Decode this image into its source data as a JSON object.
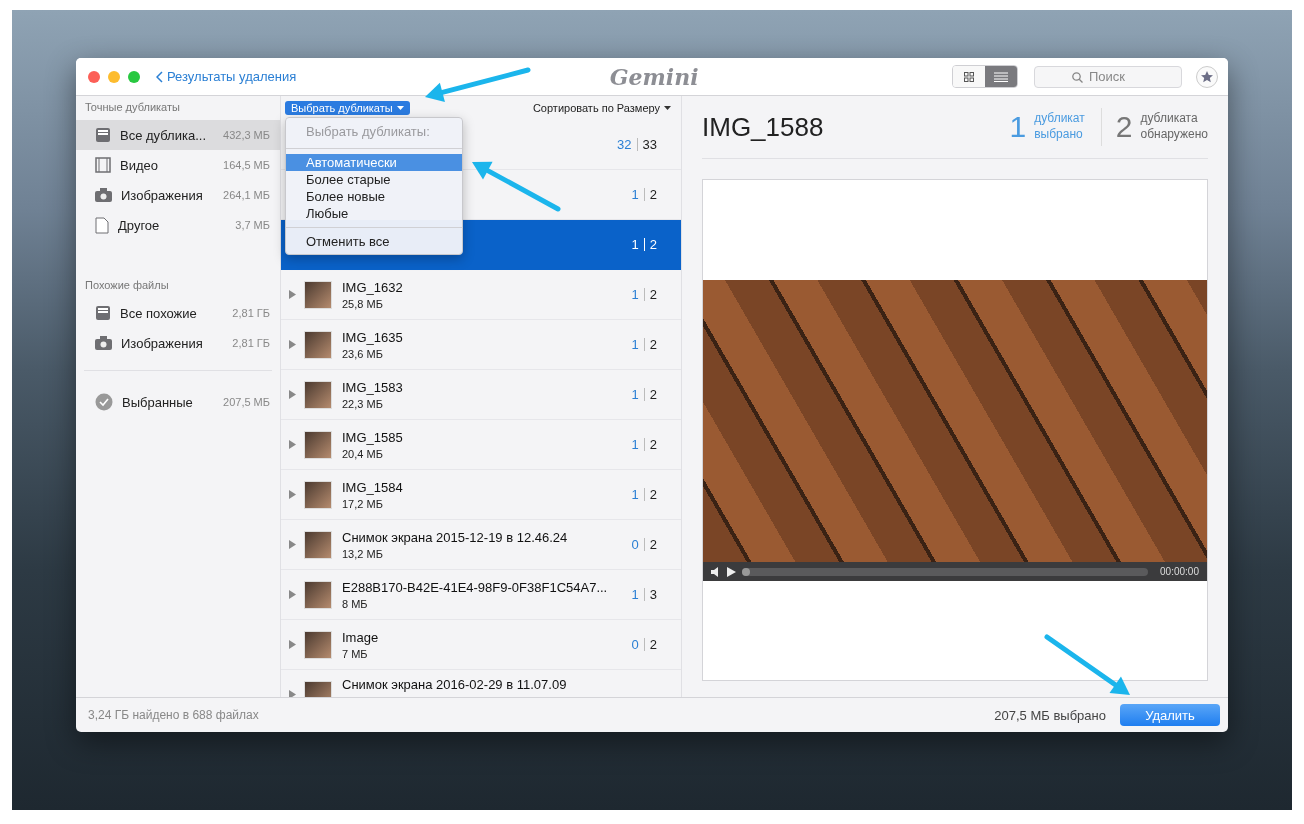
{
  "window": {
    "back_label": "Результаты удаления",
    "logo": "Gemini",
    "search": {
      "placeholder": "Поиск"
    },
    "views": [
      {
        "kind": "grid",
        "selected": false
      },
      {
        "kind": "list",
        "selected": true
      }
    ]
  },
  "sidebar": {
    "sections": [
      {
        "title": "Точные дубликаты",
        "items": [
          {
            "kind": "tray",
            "label": "Все дублика...",
            "size": "432,3 МБ",
            "selected": true
          },
          {
            "kind": "film",
            "label": "Видео",
            "size": "164,5 МБ",
            "selected": false
          },
          {
            "kind": "camera",
            "label": "Изображения",
            "size": "264,1 МБ",
            "selected": false
          },
          {
            "kind": "document",
            "label": "Другое",
            "size": "3,7 МБ",
            "selected": false
          }
        ]
      },
      {
        "title": "Похожие файлы",
        "items": [
          {
            "kind": "tray",
            "label": "Все похожие",
            "size": "2,81 ГБ",
            "selected": false
          },
          {
            "kind": "camera",
            "label": "Изображения",
            "size": "2,81 ГБ",
            "selected": false
          }
        ]
      },
      {
        "items": [
          {
            "kind": "check",
            "label": "Выбранные",
            "size": "207,5 МБ",
            "selected": false
          }
        ]
      }
    ]
  },
  "list": {
    "select_button": "Выбрать дубликаты",
    "sort_label": "Сортировать по Размеру",
    "rows": [
      {
        "selected_count": "32",
        "total_count": "33",
        "selected": false
      },
      {
        "selected_count": "1",
        "total_count": "2",
        "selected": false
      },
      {
        "selected_count": "1",
        "total_count": "2",
        "selected": true
      },
      {
        "name": "IMG_1632",
        "size": "25,8 МБ",
        "selected_count": "1",
        "total_count": "2",
        "selected": false
      },
      {
        "name": "IMG_1635",
        "size": "23,6 МБ",
        "selected_count": "1",
        "total_count": "2",
        "selected": false
      },
      {
        "name": "IMG_1583",
        "size": "22,3 МБ",
        "selected_count": "1",
        "total_count": "2",
        "selected": false
      },
      {
        "name": "IMG_1585",
        "size": "20,4 МБ",
        "selected_count": "1",
        "total_count": "2",
        "selected": false
      },
      {
        "name": "IMG_1584",
        "size": "17,2 МБ",
        "selected_count": "1",
        "total_count": "2",
        "selected": false
      },
      {
        "name": "Снимок экрана 2015-12-19 в 12.46.24",
        "size": "13,2 МБ",
        "selected_count": "0",
        "total_count": "2",
        "selected": false
      },
      {
        "name": "E288B170-B42E-41E4-98F9-0F38F1C54A7...",
        "size": "8 МБ",
        "selected_count": "1",
        "total_count": "3",
        "selected": false
      },
      {
        "name": "Image",
        "size": "7 МБ",
        "selected_count": "0",
        "total_count": "2",
        "selected": false
      },
      {
        "name": "Снимок экрана 2016-02-29 в 11.07.09",
        "selected": false
      }
    ]
  },
  "menu": {
    "items": [
      {
        "kind": "header",
        "label": "Выбрать дубликаты:"
      },
      {
        "kind": "separator"
      },
      {
        "kind": "option",
        "label": "Автоматически",
        "selected": true
      },
      {
        "kind": "option",
        "label": "Более старые",
        "selected": false
      },
      {
        "kind": "option",
        "label": "Более новые",
        "selected": false
      },
      {
        "kind": "option",
        "label": "Любые",
        "selected": false
      },
      {
        "kind": "separator"
      },
      {
        "kind": "option",
        "label": "Отменить все",
        "selected": false
      }
    ]
  },
  "detail": {
    "title": "IMG_1588",
    "selected_count": "1",
    "selected_label": "дубликат выбрано",
    "found_count": "2",
    "found_label": "дубликата обнаружено",
    "player": {
      "time": "00:00:00",
      "level": 0
    }
  },
  "status_bar": {
    "found": "3,24 ГБ найдено в 688 файлах",
    "selected": "207,5 МБ выбрано",
    "delete_button": "Удалить"
  }
}
